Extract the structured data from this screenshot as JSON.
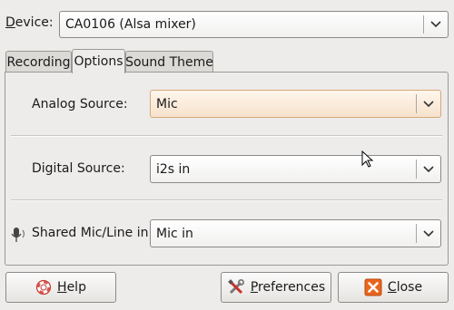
{
  "device": {
    "label_mnemonic": "D",
    "label_rest": "evice:",
    "selected": "CA0106 (Alsa mixer)"
  },
  "tabs": [
    {
      "label": "Recording",
      "active": false
    },
    {
      "label": "Options",
      "active": true
    },
    {
      "label": "Sound Theme",
      "active": false
    }
  ],
  "options": {
    "analog_source": {
      "label": "Analog Source:",
      "selected": "Mic"
    },
    "digital_source": {
      "label": "Digital Source:",
      "selected": "i2s in"
    },
    "shared_mic": {
      "label": "Shared Mic/Line in:",
      "selected": "Mic in"
    }
  },
  "buttons": {
    "help": {
      "mnemonic": "H",
      "rest": "elp",
      "icon": "help-lifebuoy-icon"
    },
    "preferences": {
      "mnemonic": "P",
      "rest": "references",
      "icon": "tools-icon"
    },
    "close": {
      "mnemonic": "C",
      "rest": "lose",
      "icon": "close-x-icon"
    }
  },
  "colors": {
    "window_bg": "#edeceb",
    "active_combo": "#f6e2cc",
    "close_icon": "#e8651c"
  }
}
